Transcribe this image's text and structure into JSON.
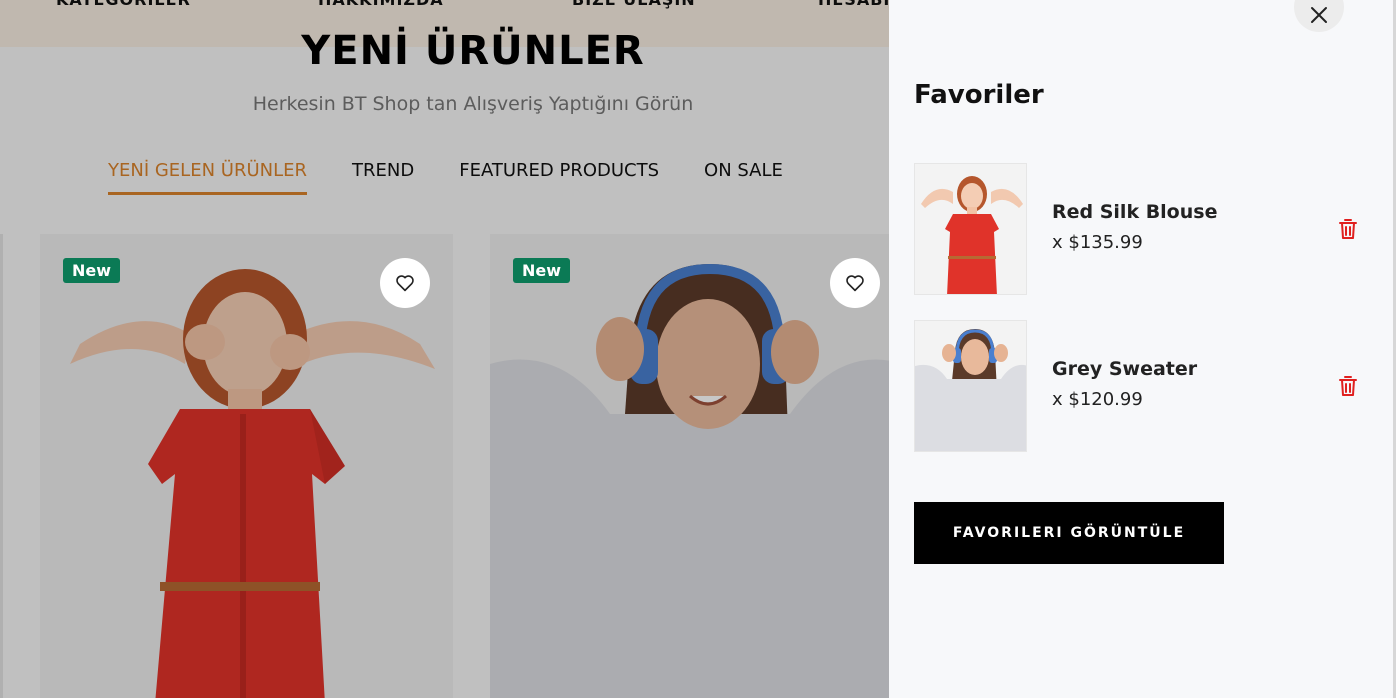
{
  "topnav": {
    "items": [
      "KATEGORİLER",
      "HAKKIMIZDA",
      "BİZE ULAŞIN",
      "HESABIM"
    ]
  },
  "section": {
    "title": "YENİ ÜRÜNLER",
    "subtitle": "Herkesin BT Shop tan Alışveriş Yaptığını Görün"
  },
  "tabs": [
    {
      "label": "YENİ GELEN ÜRÜNLER",
      "active": true
    },
    {
      "label": "TREND",
      "active": false
    },
    {
      "label": "FEATURED PRODUCTS",
      "active": false
    },
    {
      "label": "ON SALE",
      "active": false
    }
  ],
  "products": [
    {
      "badge": "New",
      "icon": "heart-icon"
    },
    {
      "badge": "New",
      "icon": "heart-icon"
    }
  ],
  "drawer": {
    "title": "Favoriler",
    "close_icon": "close-icon",
    "items": [
      {
        "name": "Red Silk Blouse",
        "price": "x $135.99",
        "delete_icon": "trash-icon"
      },
      {
        "name": "Grey Sweater",
        "price": "x $120.99",
        "delete_icon": "trash-icon"
      }
    ],
    "view_button": "FAVORILERI GÖRÜNTÜLE"
  },
  "colors": {
    "accent": "#d9822b",
    "badge": "#0b7a55",
    "delete": "#e0201f",
    "button": "#000000",
    "drawer_bg": "#f7f8fa"
  }
}
